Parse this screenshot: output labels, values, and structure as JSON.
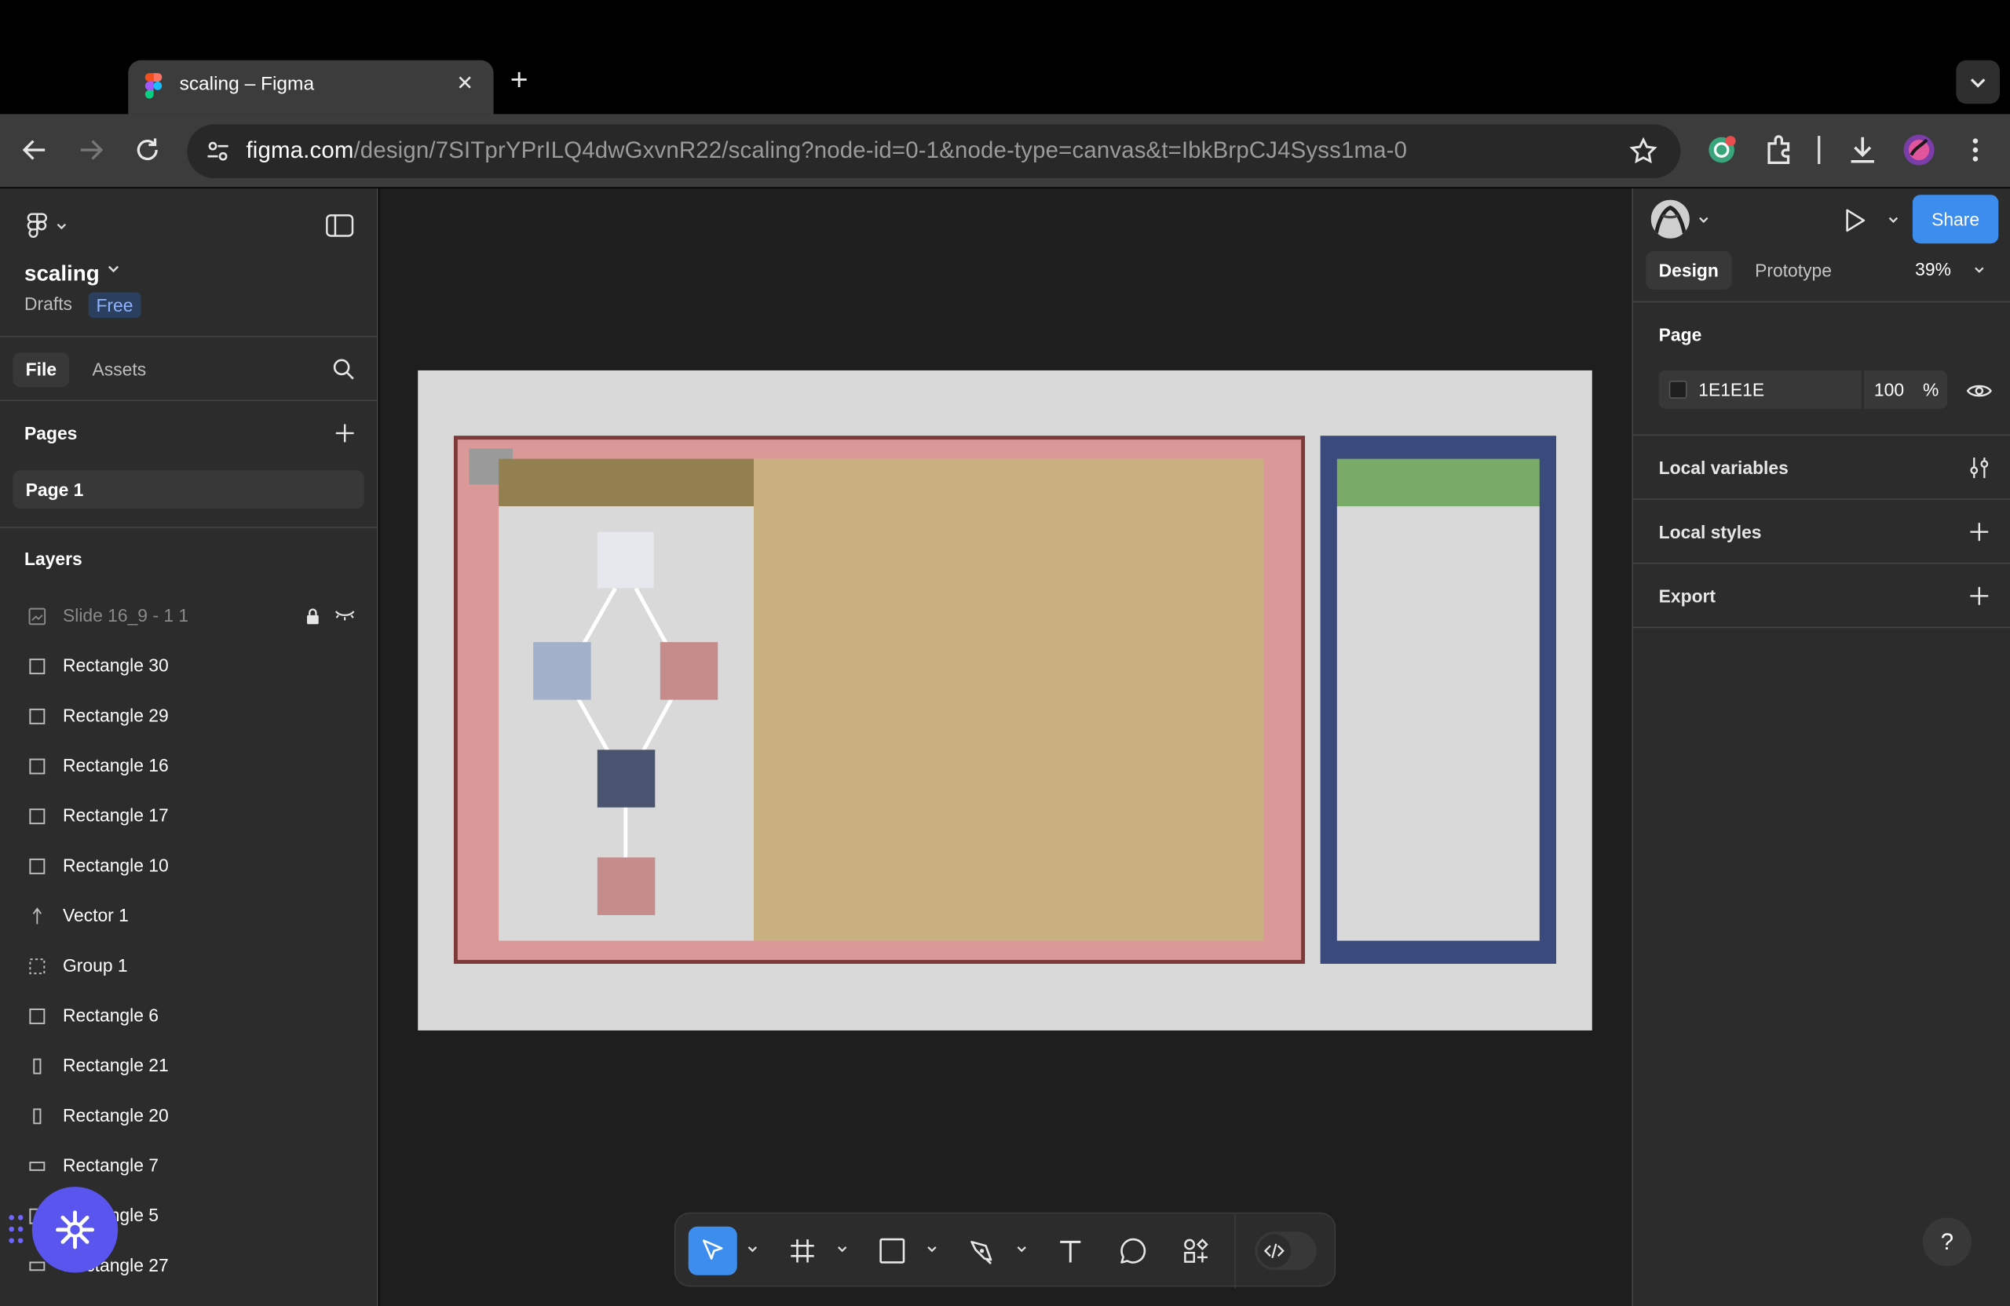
{
  "browser": {
    "tab_title": "scaling – Figma",
    "tab_close": "✕",
    "new_tab": "+",
    "url_host": "figma.com",
    "url_path": "/design/7SITprYPrILQ4dwGxvnR22/scaling?node-id=0-1&node-type=canvas&t=IbkBrpCJ4Syss1ma-0"
  },
  "left_panel": {
    "file_name": "scaling",
    "location": "Drafts",
    "plan_badge": "Free",
    "tabs": {
      "file": "File",
      "assets": "Assets"
    },
    "pages_header": "Pages",
    "pages": [
      "Page 1"
    ],
    "layers_header": "Layers",
    "layers": [
      {
        "label": "Slide 16_9 - 1 1",
        "icon": "image-icon",
        "locked": true,
        "hidden": true
      },
      {
        "label": "Rectangle 30",
        "icon": "rectangle-icon"
      },
      {
        "label": "Rectangle 29",
        "icon": "rectangle-icon"
      },
      {
        "label": "Rectangle 16",
        "icon": "rectangle-icon"
      },
      {
        "label": "Rectangle 17",
        "icon": "rectangle-icon"
      },
      {
        "label": "Rectangle 10",
        "icon": "rectangle-icon"
      },
      {
        "label": "Vector 1",
        "icon": "vector-icon"
      },
      {
        "label": "Group 1",
        "icon": "group-icon"
      },
      {
        "label": "Rectangle 6",
        "icon": "rectangle-icon"
      },
      {
        "label": "Rectangle 21",
        "icon": "tall-rectangle-icon"
      },
      {
        "label": "Rectangle 20",
        "icon": "tall-rectangle-icon"
      },
      {
        "label": "Rectangle 7",
        "icon": "wide-rectangle-icon"
      },
      {
        "label": "Rectangle 5",
        "icon": "rectangle-icon"
      },
      {
        "label": "Rectangle 27",
        "icon": "wide-rectangle-icon"
      }
    ]
  },
  "canvas": {
    "frame_fill": "#D9D9D9",
    "colors": {
      "pink": "#DB9898",
      "maroon": "#7E3A3A",
      "olive": "#938050",
      "tan": "#C8B080",
      "light": "#D9D9D9",
      "navy": "#3B4A7C",
      "green": "#7AAA68",
      "node_top": "#E6E8EE",
      "node_blue": "#A2B0CA",
      "node_rose": "#C68B8B",
      "node_dark": "#4A5470"
    }
  },
  "toolbar": {
    "tools": [
      "move-tool",
      "frame-tool",
      "rectangle-tool",
      "pen-tool",
      "text-tool",
      "comment-tool",
      "actions-tool"
    ],
    "active_tool": "move-tool"
  },
  "right_panel": {
    "share_label": "Share",
    "tabs": {
      "design": "Design",
      "prototype": "Prototype"
    },
    "zoom": "39%",
    "page_header": "Page",
    "page_color": "1E1E1E",
    "page_opacity": "100",
    "opacity_unit": "%",
    "local_variables": "Local variables",
    "local_styles": "Local styles",
    "export": "Export",
    "help": "?"
  }
}
